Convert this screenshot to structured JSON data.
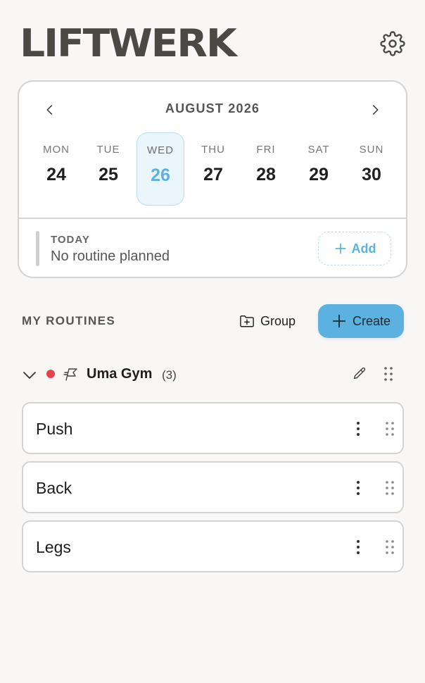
{
  "app": {
    "brand": "LIFTWERK"
  },
  "calendar": {
    "month_label": "AUGUST 2026",
    "days": [
      {
        "dow": "MON",
        "num": "24",
        "selected": false
      },
      {
        "dow": "TUE",
        "num": "25",
        "selected": false
      },
      {
        "dow": "WED",
        "num": "26",
        "selected": true
      },
      {
        "dow": "THU",
        "num": "27",
        "selected": false
      },
      {
        "dow": "FRI",
        "num": "28",
        "selected": false
      },
      {
        "dow": "SAT",
        "num": "29",
        "selected": false
      },
      {
        "dow": "SUN",
        "num": "30",
        "selected": false
      }
    ],
    "today_label": "TODAY",
    "today_text": "No routine planned",
    "add_label": "Add"
  },
  "routines": {
    "title": "MY ROUTINES",
    "group_label": "Group",
    "create_label": "Create",
    "groups": [
      {
        "name": "Uma Gym",
        "count": "(3)",
        "color": "#e5444a",
        "items": [
          {
            "name": "Push"
          },
          {
            "name": "Back"
          },
          {
            "name": "Legs"
          }
        ]
      }
    ]
  },
  "colors": {
    "accent": "#5bb2e0",
    "brand_text": "#4a4944",
    "group_dot": "#e5444a"
  },
  "icons": [
    "gear-icon",
    "chevron-left-icon",
    "chevron-right-icon",
    "plus-icon",
    "folder-plus-icon",
    "chevron-down-icon",
    "flag-icon",
    "pencil-icon",
    "drag-handle-icon",
    "more-vertical-icon"
  ]
}
